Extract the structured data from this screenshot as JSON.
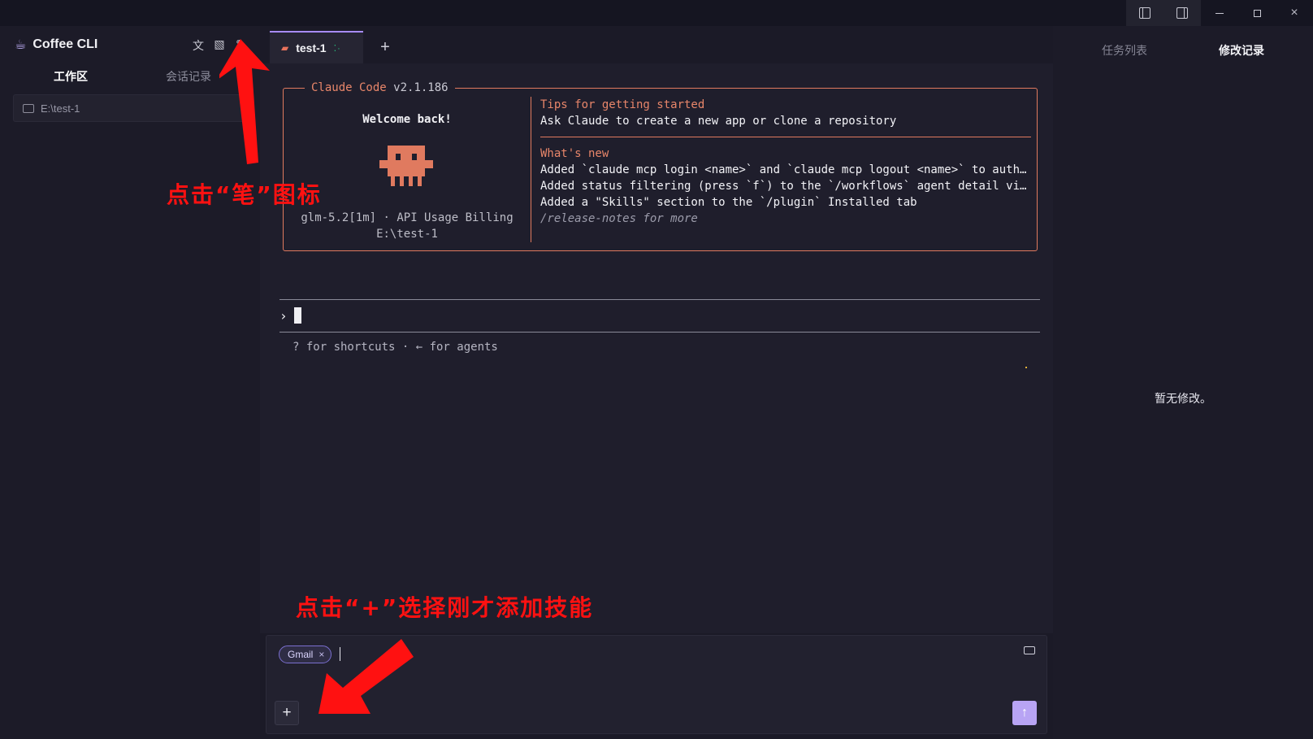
{
  "window": {
    "controls": [
      "toggle-left-panel-icon",
      "toggle-right-panel-icon",
      "minimize-icon",
      "maximize-icon",
      "close-icon"
    ],
    "close_glyph": "×",
    "min_glyph": "—"
  },
  "sidebar": {
    "app_title": "Coffee CLI",
    "tool_icons": [
      "translate-icon",
      "image-icon",
      "pen-icon"
    ],
    "tool_glyphs": {
      "translate": "文",
      "image": "▧",
      "pen": "✎"
    },
    "tabs": [
      {
        "label": "工作区",
        "active": true
      },
      {
        "label": "会话记录",
        "active": false
      }
    ],
    "folder_path": "E:\\test-1"
  },
  "tabs": {
    "items": [
      {
        "label": "test-1",
        "active": true
      }
    ],
    "add_glyph": "+"
  },
  "terminal": {
    "box_title_a": "Claude Code",
    "box_title_b": "v2.1.186",
    "welcome": "Welcome back!",
    "model_line": "glm-5.2[1m] · API Usage Billing",
    "path_line": "E:\\test-1",
    "tips_title": "Tips for getting started",
    "tips_text": "Ask Claude to create a new app or clone a repository",
    "whats_new_title": "What's new",
    "whats_new": [
      "Added `claude mcp login <name>` and `claude mcp logout <name>` to authentic…",
      "Added status filtering (press `f`) to the `/workflows` agent detail view",
      "Added a \"Skills\" section to the `/plugin` Installed tab"
    ],
    "release_notes": "/release-notes for more",
    "prompt_symbol": "›",
    "hint": "? for shortcuts · ← for agents"
  },
  "right_panel": {
    "tabs": [
      {
        "label": "任务列表",
        "active": false
      },
      {
        "label": "修改记录",
        "active": true
      }
    ],
    "empty_text": "暂无修改。"
  },
  "composer": {
    "chip_label": "Gmail",
    "chip_close": "×",
    "value": "",
    "plus_glyph": "+",
    "send_glyph": "↑"
  },
  "annotations": {
    "pen_hint": "点击“笔”图标",
    "plus_hint": "点击“+”选择刚才添加技能",
    "color": "#ff1111"
  },
  "colors": {
    "accent": "#a78bfa",
    "claude_orange": "#e07a5f",
    "background": "#1b1a27",
    "send_button": "#b8a4f4"
  }
}
